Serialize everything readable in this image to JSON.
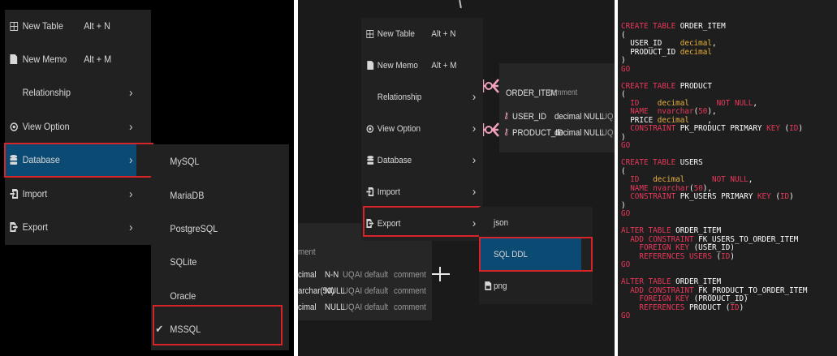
{
  "colors": {
    "selected": "#0b4a72",
    "highlight_box": "#d6242b",
    "keyword": "#e8385a",
    "type": "#e8b23a"
  },
  "left_menu": {
    "items": [
      {
        "icon": "table-icon",
        "label": "New Table",
        "shortcut": "Alt + N"
      },
      {
        "icon": "memo-icon",
        "label": "New Memo",
        "shortcut": "Alt + M"
      },
      {
        "icon": "",
        "label": "Relationship",
        "arrow": "›"
      },
      {
        "icon": "eye-icon",
        "label": "View Option",
        "arrow": "›"
      },
      {
        "icon": "database-icon",
        "label": "Database",
        "arrow": "›",
        "selected": true
      },
      {
        "icon": "import-icon",
        "label": "Import",
        "arrow": "›"
      },
      {
        "icon": "export-icon",
        "label": "Export",
        "arrow": "›"
      }
    ],
    "database_submenu": [
      {
        "label": "MySQL"
      },
      {
        "label": "MariaDB"
      },
      {
        "label": "PostgreSQL"
      },
      {
        "label": "SQLite"
      },
      {
        "label": "Oracle"
      },
      {
        "label": "MSSQL",
        "checked": true,
        "check": "✔"
      }
    ]
  },
  "middle_menu": {
    "items": [
      {
        "icon": "table-icon",
        "label": "New Table",
        "shortcut": "Alt + N"
      },
      {
        "icon": "memo-icon",
        "label": "New Memo",
        "shortcut": "Alt + M"
      },
      {
        "icon": "",
        "label": "Relationship",
        "arrow": "›"
      },
      {
        "icon": "eye-icon",
        "label": "View Option",
        "arrow": "›"
      },
      {
        "icon": "database-icon",
        "label": "Database",
        "arrow": "›"
      },
      {
        "icon": "import-icon",
        "label": "Import",
        "arrow": "›"
      },
      {
        "icon": "export-icon",
        "label": "Export",
        "arrow": "›",
        "selected": true
      }
    ],
    "export_submenu": [
      {
        "label": "json"
      },
      {
        "label": "SQL DDL",
        "selected": true
      },
      {
        "icon": "image-icon",
        "label": "png"
      }
    ]
  },
  "diagram": {
    "order_item": {
      "name": "ORDER_ITEM",
      "comment": "comment",
      "columns": [
        {
          "name": "USER_ID",
          "type": "decimal",
          "nullable": "NULL",
          "extra": "UQ"
        },
        {
          "name": "PRODUCT_ID",
          "type": "decimal",
          "nullable": "NULL",
          "extra": "UQ"
        }
      ]
    },
    "partial_table": {
      "comment_header": "ment",
      "rows": [
        {
          "type": "cimal",
          "nn": "N-N",
          "uq": "UQ",
          "ai": "AI",
          "default": "default",
          "comment": "comment"
        },
        {
          "type": "archar(50)",
          "nn": "NULL",
          "uq": "UQ",
          "ai": "AI",
          "default": "default",
          "comment": "comment"
        },
        {
          "type": "cimal",
          "nn": "NULL",
          "uq": "UQ",
          "ai": "AI",
          "default": "default",
          "comment": "comment"
        }
      ]
    }
  },
  "sql_ddl": [
    [
      [
        "k",
        "CREATE TABLE"
      ],
      [
        "w",
        " ORDER_ITEM"
      ]
    ],
    [
      [
        "w",
        "("
      ]
    ],
    [
      [
        "w",
        "  USER_ID    "
      ],
      [
        "y",
        "decimal"
      ],
      [
        "w",
        ","
      ]
    ],
    [
      [
        "w",
        "  PRODUCT_ID "
      ],
      [
        "y",
        "decimal"
      ]
    ],
    [
      [
        "w",
        ")"
      ]
    ],
    [
      [
        "k",
        "GO"
      ]
    ],
    [
      [
        "w",
        ""
      ]
    ],
    [
      [
        "k",
        "CREATE TABLE"
      ],
      [
        "w",
        " PRODUCT"
      ]
    ],
    [
      [
        "w",
        "("
      ]
    ],
    [
      [
        "w",
        "  "
      ],
      [
        "k",
        "ID"
      ],
      [
        "w",
        "    "
      ],
      [
        "y",
        "decimal"
      ],
      [
        "w",
        "      "
      ],
      [
        "k",
        "NOT NULL"
      ],
      [
        "w",
        ","
      ]
    ],
    [
      [
        "w",
        "  "
      ],
      [
        "k",
        "NAME"
      ],
      [
        "w",
        "  "
      ],
      [
        "k",
        "nvarchar"
      ],
      [
        "w",
        "("
      ],
      [
        "k",
        "50"
      ],
      [
        "w",
        "),"
      ]
    ],
    [
      [
        "w",
        "  PRICE "
      ],
      [
        "y",
        "decimal"
      ],
      [
        "w",
        "    ,"
      ]
    ],
    [
      [
        "w",
        "  "
      ],
      [
        "k",
        "CONSTRAINT"
      ],
      [
        "w",
        " PK_PRODUCT PRIMARY "
      ],
      [
        "k",
        "KEY"
      ],
      [
        "w",
        " ("
      ],
      [
        "k",
        "ID"
      ],
      [
        "w",
        ")"
      ]
    ],
    [
      [
        "w",
        ")"
      ]
    ],
    [
      [
        "k",
        "GO"
      ]
    ],
    [
      [
        "w",
        ""
      ]
    ],
    [
      [
        "k",
        "CREATE TABLE"
      ],
      [
        "w",
        " USERS"
      ]
    ],
    [
      [
        "w",
        "("
      ]
    ],
    [
      [
        "w",
        "  "
      ],
      [
        "k",
        "ID"
      ],
      [
        "w",
        "   "
      ],
      [
        "y",
        "decimal"
      ],
      [
        "w",
        "      "
      ],
      [
        "k",
        "NOT"
      ],
      [
        "w",
        " "
      ],
      [
        "k",
        "NULL"
      ],
      [
        "w",
        ","
      ]
    ],
    [
      [
        "w",
        "  "
      ],
      [
        "k",
        "NAME"
      ],
      [
        "w",
        " "
      ],
      [
        "k",
        "nvarchar"
      ],
      [
        "w",
        "("
      ],
      [
        "k",
        "50"
      ],
      [
        "w",
        "),"
      ]
    ],
    [
      [
        "w",
        "  "
      ],
      [
        "k",
        "CONSTRAINT"
      ],
      [
        "w",
        " PK_USERS PRIMARY "
      ],
      [
        "k",
        "KEY"
      ],
      [
        "w",
        " ("
      ],
      [
        "k",
        "ID"
      ],
      [
        "w",
        ")"
      ]
    ],
    [
      [
        "w",
        ")"
      ]
    ],
    [
      [
        "k",
        "GO"
      ]
    ],
    [
      [
        "w",
        ""
      ]
    ],
    [
      [
        "k",
        "ALTER TABLE"
      ],
      [
        "w",
        " ORDER_ITEM"
      ]
    ],
    [
      [
        "w",
        "  "
      ],
      [
        "k",
        "ADD CONSTRAINT"
      ],
      [
        "w",
        " FK_USERS_TO_ORDER_ITEM"
      ]
    ],
    [
      [
        "w",
        "    "
      ],
      [
        "k",
        "FOREIGN KEY"
      ],
      [
        "w",
        " (USER_ID)"
      ]
    ],
    [
      [
        "w",
        "    "
      ],
      [
        "k",
        "REFERENCES USERS"
      ],
      [
        "w",
        " ("
      ],
      [
        "k",
        "ID"
      ],
      [
        "w",
        ")"
      ]
    ],
    [
      [
        "k",
        "GO"
      ]
    ],
    [
      [
        "w",
        ""
      ]
    ],
    [
      [
        "k",
        "ALTER TABLE"
      ],
      [
        "w",
        " ORDER_ITEM"
      ]
    ],
    [
      [
        "w",
        "  "
      ],
      [
        "k",
        "ADD CONSTRAINT"
      ],
      [
        "w",
        " FK_PRODUCT_TO_ORDER_ITEM"
      ]
    ],
    [
      [
        "w",
        "    "
      ],
      [
        "k",
        "FOREIGN KEY"
      ],
      [
        "w",
        " (PRODUCT_ID)"
      ]
    ],
    [
      [
        "w",
        "    "
      ],
      [
        "k",
        "REFERENCES"
      ],
      [
        "w",
        " PRODUCT ("
      ],
      [
        "k",
        "ID"
      ],
      [
        "w",
        ")"
      ]
    ],
    [
      [
        "k",
        "GO"
      ]
    ]
  ]
}
